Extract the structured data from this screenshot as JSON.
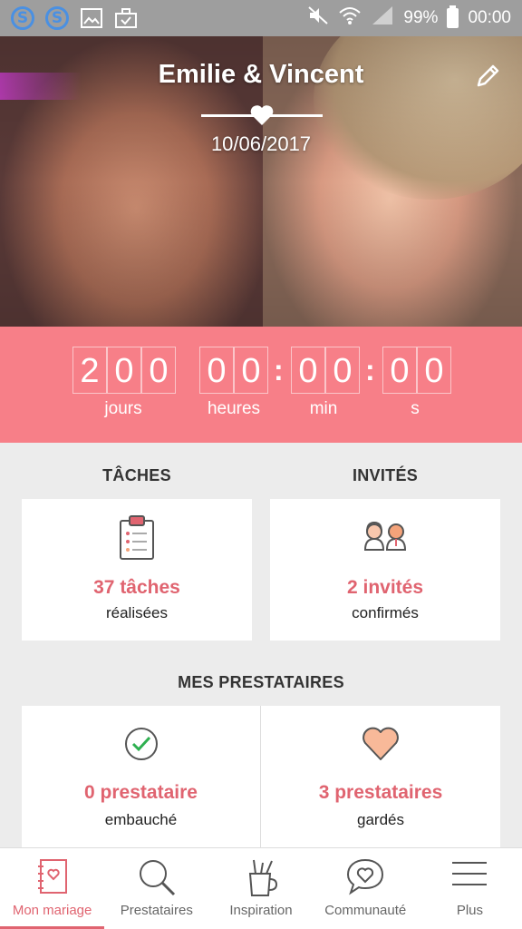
{
  "status_bar": {
    "battery": "99%",
    "time": "00:00",
    "icons": [
      "s-app-icon",
      "s-app-icon",
      "image-icon",
      "briefcase-icon",
      "mute-icon",
      "wifi-icon",
      "signal-icon",
      "battery-icon"
    ]
  },
  "hero": {
    "couple_name": "Emilie & Vincent",
    "wedding_date": "10/06/2017",
    "edit_icon": "pencil-icon"
  },
  "countdown": {
    "days": [
      "2",
      "0",
      "0"
    ],
    "hours": [
      "0",
      "0"
    ],
    "minutes": [
      "0",
      "0"
    ],
    "seconds": [
      "0",
      "0"
    ],
    "labels": {
      "days": "jours",
      "hours": "heures",
      "minutes": "min",
      "seconds": "s"
    },
    "color": "#f77f88"
  },
  "tasks": {
    "title": "TÂCHES",
    "value": "37 tâches",
    "sub": "réalisées",
    "icon": "clipboard-icon"
  },
  "guests": {
    "title": "INVITÉS",
    "value": "2 invités",
    "sub": "confirmés",
    "icon": "couple-icon"
  },
  "vendors": {
    "title": "MES PRESTATAIRES",
    "hired": {
      "value": "0 prestataire",
      "sub": "embauché",
      "icon": "check-circle-icon"
    },
    "saved": {
      "value": "3 prestataires",
      "sub": "gardés",
      "icon": "heart-icon"
    }
  },
  "nav": {
    "items": [
      {
        "label": "Mon mariage",
        "icon": "notebook-icon",
        "active": true
      },
      {
        "label": "Prestataires",
        "icon": "search-icon",
        "active": false
      },
      {
        "label": "Inspiration",
        "icon": "pencil-cup-icon",
        "active": false
      },
      {
        "label": "Communauté",
        "icon": "chat-heart-icon",
        "active": false
      },
      {
        "label": "Plus",
        "icon": "menu-icon",
        "active": false
      }
    ]
  },
  "colors": {
    "accent": "#e06470",
    "countdown_bg": "#f77f88",
    "status_bar": "#9e9e9e"
  }
}
